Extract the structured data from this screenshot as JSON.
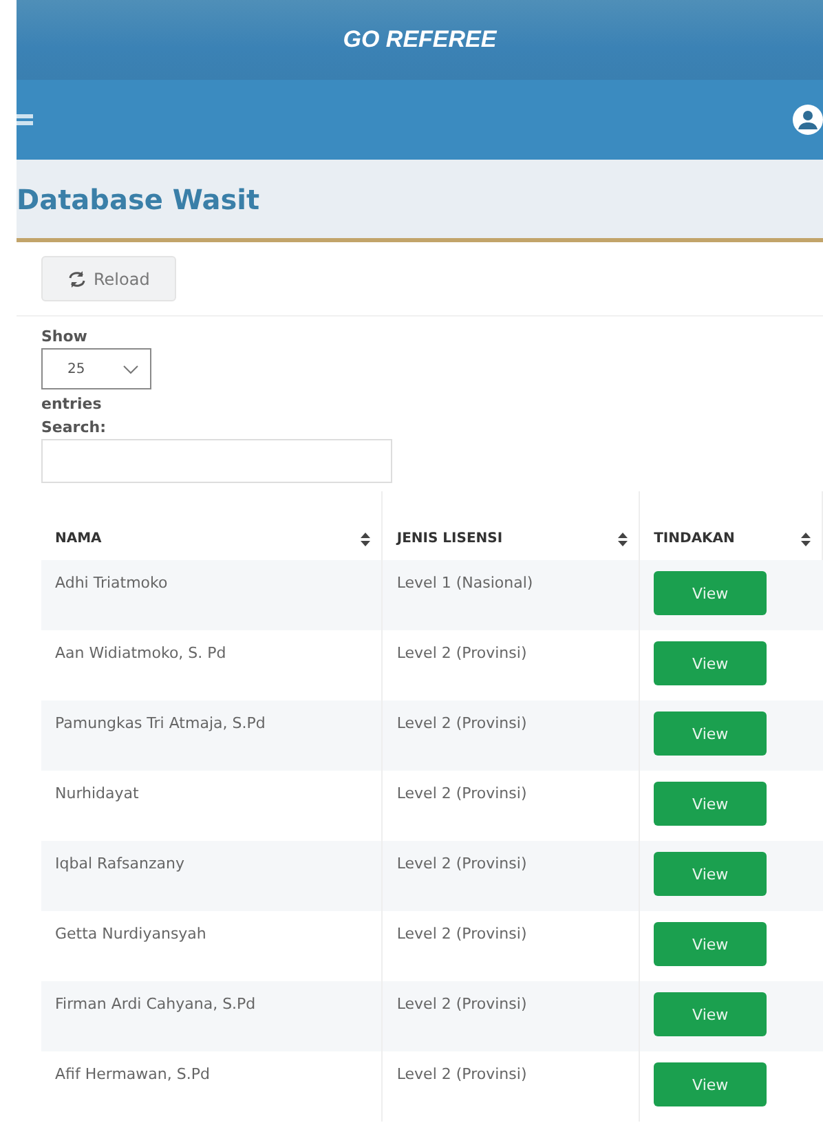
{
  "app_title": "GO REFEREE",
  "page_title": "Database Wasit",
  "reload_button": "Reload",
  "length": {
    "label_before": "Show",
    "value": "25",
    "label_after": "entries"
  },
  "search": {
    "label": "Search:"
  },
  "table": {
    "columns": [
      "NAMA",
      "JENIS LISENSI",
      "TINDAKAN"
    ],
    "rows": [
      {
        "name": "Adhi Triatmoko",
        "license": "Level 1 (Nasional)",
        "action": "View"
      },
      {
        "name": "Aan Widiatmoko, S. Pd",
        "license": "Level 2 (Provinsi)",
        "action": "View"
      },
      {
        "name": "Pamungkas Tri Atmaja, S.Pd",
        "license": "Level 2 (Provinsi)",
        "action": "View"
      },
      {
        "name": "Nurhidayat",
        "license": "Level 2 (Provinsi)",
        "action": "View"
      },
      {
        "name": "Iqbal Rafsanzany",
        "license": "Level 2 (Provinsi)",
        "action": "View"
      },
      {
        "name": "Getta Nurdiyansyah",
        "license": "Level 2 (Provinsi)",
        "action": "View"
      },
      {
        "name": "Firman Ardi Cahyana, S.Pd",
        "license": "Level 2 (Provinsi)",
        "action": "View"
      },
      {
        "name": "Afif Hermawan, S.Pd",
        "license": "Level 2 (Provinsi)",
        "action": "View"
      }
    ]
  }
}
